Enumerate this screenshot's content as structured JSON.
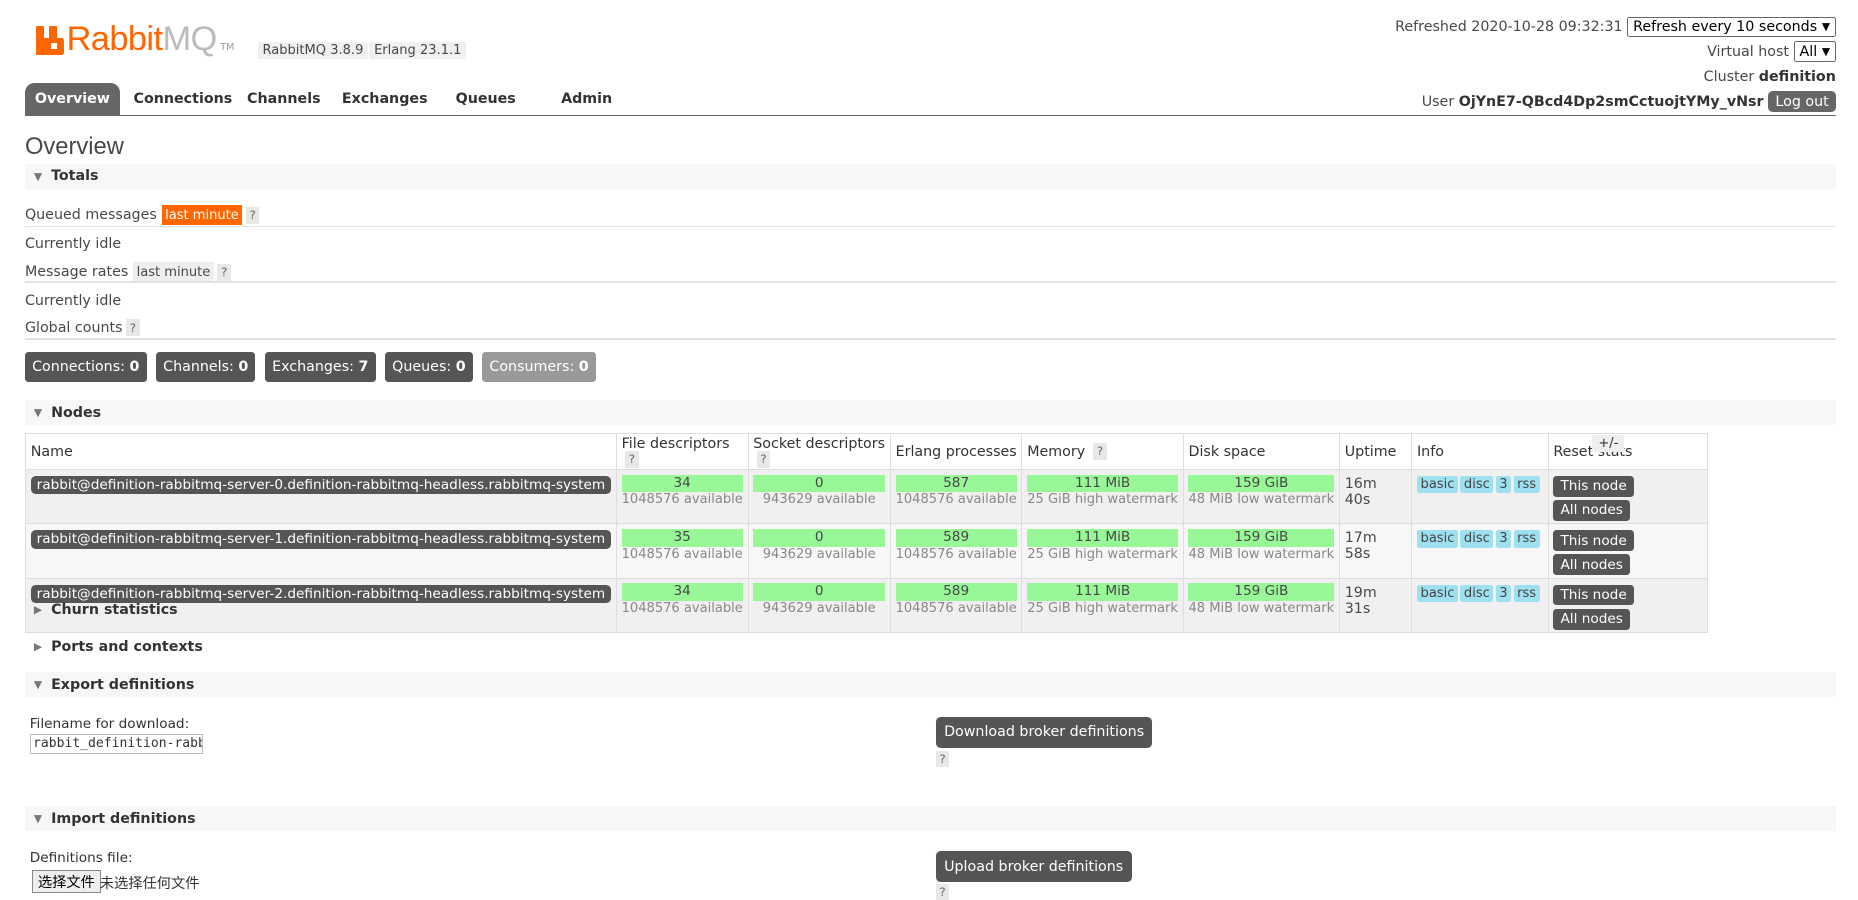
{
  "logo": {
    "rabbit": "Rabbit",
    "mq": "MQ",
    "tm": "TM"
  },
  "versions": {
    "rabbitmq": "RabbitMQ 3.8.9",
    "erlang": "Erlang 23.1.1"
  },
  "header": {
    "refreshed": "Refreshed 2020-10-28 09:32:31",
    "refresh_select": "Refresh every 10 seconds",
    "vhost_label": "Virtual host",
    "vhost_select": "All",
    "cluster_label": "Cluster",
    "cluster_name": "definition",
    "user_label": "User",
    "user_name": "OjYnE7-QBcd4Dp2smCctuojtYMy_vNsr",
    "logout": "Log out"
  },
  "tabs": [
    "Overview",
    "Connections",
    "Channels",
    "Exchanges",
    "Queues",
    "Admin"
  ],
  "page_title": "Overview",
  "totals": {
    "title": "Totals",
    "queued_label": "Queued messages",
    "queued_badge": "last minute",
    "help": "?",
    "idle1": "Currently idle",
    "rates_label": "Message rates",
    "rates_badge": "last minute",
    "idle2": "Currently idle",
    "global_label": "Global counts"
  },
  "counts": [
    {
      "label": "Connections:",
      "value": "0"
    },
    {
      "label": "Channels:",
      "value": "0"
    },
    {
      "label": "Exchanges:",
      "value": "7"
    },
    {
      "label": "Queues:",
      "value": "0"
    },
    {
      "label": "Consumers:",
      "value": "0"
    }
  ],
  "nodes": {
    "title": "Nodes",
    "plusminus": "+/-",
    "headers": {
      "name": "Name",
      "fd": "File descriptors",
      "sd": "Socket descriptors",
      "ep": "Erlang processes",
      "mem": "Memory",
      "disk": "Disk space",
      "uptime": "Uptime",
      "info": "Info",
      "reset": "Reset stats"
    },
    "rows": [
      {
        "name": "rabbit@definition-rabbitmq-server-0.definition-rabbitmq-headless.rabbitmq-system",
        "fd": "34",
        "fd_avail": "1048576 available",
        "sd": "0",
        "sd_avail": "943629 available",
        "ep": "587",
        "ep_avail": "1048576 available",
        "mem": "111 MiB",
        "mem_sub": "25 GiB high watermark",
        "disk": "159 GiB",
        "disk_sub": "48 MiB low watermark",
        "uptime": "16m 40s",
        "info": [
          "basic",
          "disc",
          "3",
          "rss"
        ],
        "btn1": "This node",
        "btn2": "All nodes"
      },
      {
        "name": "rabbit@definition-rabbitmq-server-1.definition-rabbitmq-headless.rabbitmq-system",
        "fd": "35",
        "fd_avail": "1048576 available",
        "sd": "0",
        "sd_avail": "943629 available",
        "ep": "589",
        "ep_avail": "1048576 available",
        "mem": "111 MiB",
        "mem_sub": "25 GiB high watermark",
        "disk": "159 GiB",
        "disk_sub": "48 MiB low watermark",
        "uptime": "17m 58s",
        "info": [
          "basic",
          "disc",
          "3",
          "rss"
        ],
        "btn1": "This node",
        "btn2": "All nodes"
      },
      {
        "name": "rabbit@definition-rabbitmq-server-2.definition-rabbitmq-headless.rabbitmq-system",
        "fd": "34",
        "fd_avail": "1048576 available",
        "sd": "0",
        "sd_avail": "943629 available",
        "ep": "589",
        "ep_avail": "1048576 available",
        "mem": "111 MiB",
        "mem_sub": "25 GiB high watermark",
        "disk": "159 GiB",
        "disk_sub": "48 MiB low watermark",
        "uptime": "19m 31s",
        "info": [
          "basic",
          "disc",
          "3",
          "rss"
        ],
        "btn1": "This node",
        "btn2": "All nodes"
      }
    ]
  },
  "churn": {
    "title": "Churn statistics"
  },
  "ports": {
    "title": "Ports and contexts"
  },
  "export": {
    "title": "Export definitions",
    "filename_label": "Filename for download:",
    "filename_value": "rabbit_definition-rabbitmq-server",
    "button": "Download broker definitions",
    "help": "?"
  },
  "import": {
    "title": "Import definitions",
    "file_label": "Definitions file:",
    "choose_button": "选择文件",
    "no_file": "未选择任何文件",
    "button": "Upload broker definitions",
    "help": "?"
  },
  "colors": {
    "brand": "#ff6600",
    "bar_green": "#98f898",
    "info_blue": "#9ee0f0",
    "dark_button": "#555555"
  }
}
